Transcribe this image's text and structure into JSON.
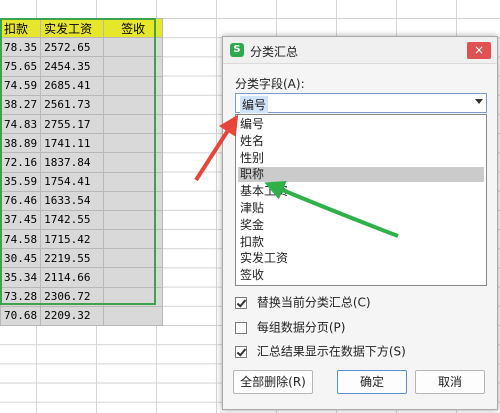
{
  "sheet": {
    "headers": [
      "扣款",
      "实发工资",
      "签收"
    ],
    "rows": [
      [
        "78.35",
        "2572.65"
      ],
      [
        "75.65",
        "2454.35"
      ],
      [
        "74.59",
        "2685.41"
      ],
      [
        "38.27",
        "2561.73"
      ],
      [
        "74.83",
        "2755.17"
      ],
      [
        "38.89",
        "1741.11"
      ],
      [
        "72.16",
        "1837.84"
      ],
      [
        "35.59",
        "1754.41"
      ],
      [
        "76.46",
        "1633.54"
      ],
      [
        "37.45",
        "1742.55"
      ],
      [
        "74.58",
        "1715.42"
      ],
      [
        "30.45",
        "2219.55"
      ],
      [
        "35.34",
        "2114.66"
      ],
      [
        "73.28",
        "2306.72"
      ],
      [
        "70.68",
        "2209.32"
      ]
    ]
  },
  "dialog": {
    "app_icon": "S",
    "title": "分类汇总",
    "close": "×",
    "field_label": "分类字段(A):",
    "combo_value": "编号",
    "dropdown_items": [
      "编号",
      "姓名",
      "性别",
      "职称",
      "基本工资",
      "津贴",
      "奖金",
      "扣款",
      "实发工资",
      "签收"
    ],
    "selected_item": "职称",
    "options": [
      {
        "label": "替换当前分类汇总(C)",
        "checked": true
      },
      {
        "label": "每组数据分页(P)",
        "checked": false
      },
      {
        "label": "汇总结果显示在数据下方(S)",
        "checked": true
      }
    ],
    "buttons": {
      "delete_all": "全部删除(R)",
      "ok": "确定",
      "cancel": "取消"
    }
  },
  "colors": {
    "header_yellow": "#e6e62a",
    "selection_green": "#3fa34d",
    "arrow_red": "#e8443a",
    "arrow_green": "#2fb14a"
  }
}
